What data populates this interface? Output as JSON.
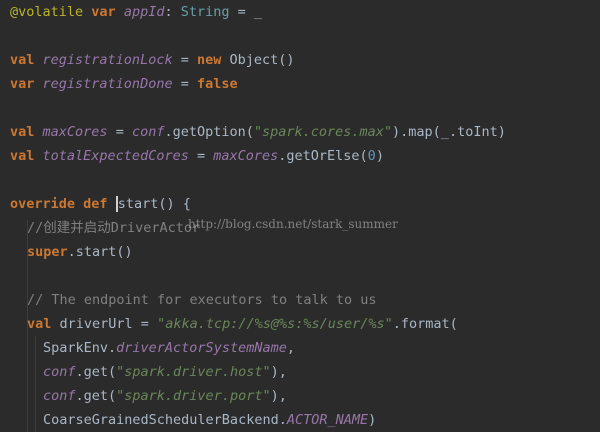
{
  "code": {
    "l1": {
      "annotation": "@volatile",
      "kw": "var",
      "name": "appId",
      "colon": ":",
      "type": "String",
      "rest": " = _"
    },
    "l3": {
      "kw": "val",
      "name": "registrationLock",
      "eq": " = ",
      "kw2": "new",
      "rest": " Object()"
    },
    "l4": {
      "kw": "var",
      "name": "registrationDone",
      "eq": " = ",
      "val": "false"
    },
    "l6": {
      "kw": "val",
      "name": "maxCores",
      "eq": " = ",
      "obj": "conf",
      "mid": ".getOption(",
      "str": "\"spark.cores.max\"",
      "rest": ").map(_.toInt)"
    },
    "l7": {
      "kw": "val",
      "name": "totalExpectedCores",
      "eq": " = ",
      "obj": "maxCores",
      "mid": ".getOrElse(",
      "num": "0",
      "rest": ")"
    },
    "l9": {
      "kw1": "override",
      "kw2": "def",
      "name": "start",
      "rest": "() {"
    },
    "l10": {
      "comment": "//创建并启动DriverActor"
    },
    "l11": {
      "kw": "super",
      "rest": ".start()"
    },
    "l13": {
      "comment": "// The endpoint for executors to talk to us"
    },
    "l14": {
      "kw": "val",
      "name": " driverUrl = ",
      "str": "\"akka.tcp://%s@%s:%s/user/%s\"",
      "rest": ".format("
    },
    "l15": {
      "pre": "SparkEnv.",
      "field": "driverActorSystemName",
      "rest": ","
    },
    "l16": {
      "obj": "conf",
      "mid": ".get(",
      "str": "\"spark.driver.host\"",
      "rest": "),"
    },
    "l17": {
      "obj": "conf",
      "mid": ".get(",
      "str": "\"spark.driver.port\"",
      "rest": "),"
    },
    "l18": {
      "pre": "CoarseGrainedSchedulerBackend.",
      "field": "ACTOR_NAME",
      "rest": ")"
    }
  },
  "watermark": "http://blog.csdn.net/stark_summer",
  "colors": {
    "background": "#2b2b2b",
    "keyword": "#cc7832",
    "string": "#6a8759",
    "field": "#9876aa",
    "comment": "#808080",
    "annotation": "#bbb529",
    "number": "#6897bb"
  }
}
